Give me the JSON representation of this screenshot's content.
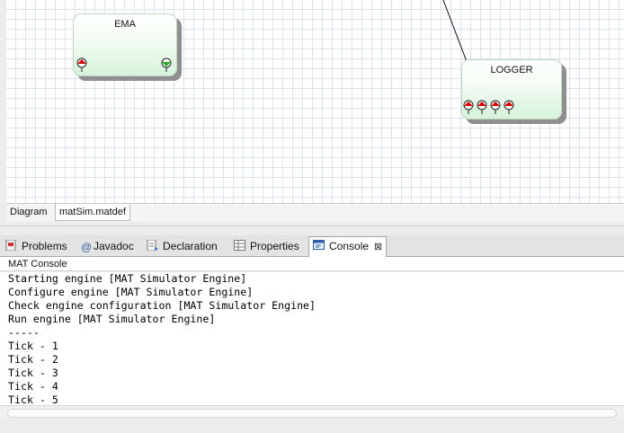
{
  "diagram": {
    "nodes": [
      {
        "id": "ema",
        "title": "EMA"
      },
      {
        "id": "logger",
        "title": "LOGGER"
      }
    ],
    "port_icons": [
      "input-port-icon",
      "output-port-icon"
    ]
  },
  "editor_tabs": [
    {
      "label": "Diagram",
      "active": false
    },
    {
      "label": "matSim.matdef",
      "active": true
    }
  ],
  "views": {
    "tabs": [
      {
        "label": "Problems",
        "icon": "problems-icon"
      },
      {
        "label": "Javadoc",
        "icon": "javadoc-at-icon"
      },
      {
        "label": "Declaration",
        "icon": "declaration-icon"
      },
      {
        "label": "Properties",
        "icon": "properties-icon"
      },
      {
        "label": "Console",
        "icon": "console-icon",
        "active": true,
        "close_glyph": "⊠"
      }
    ]
  },
  "console": {
    "title": "MAT Console",
    "lines": [
      "Starting engine [MAT Simulator Engine]",
      "Configure engine [MAT Simulator Engine]",
      "Check engine configuration [MAT Simulator Engine]",
      "Run engine [MAT Simulator Engine]",
      "-----",
      "Tick - 1",
      "Tick - 2",
      "Tick - 3",
      "Tick - 4",
      "Tick - 5"
    ]
  },
  "colors": {
    "node_fill": "#d6f3d9",
    "input_port": "#d40000",
    "output_port": "#22aa22"
  }
}
